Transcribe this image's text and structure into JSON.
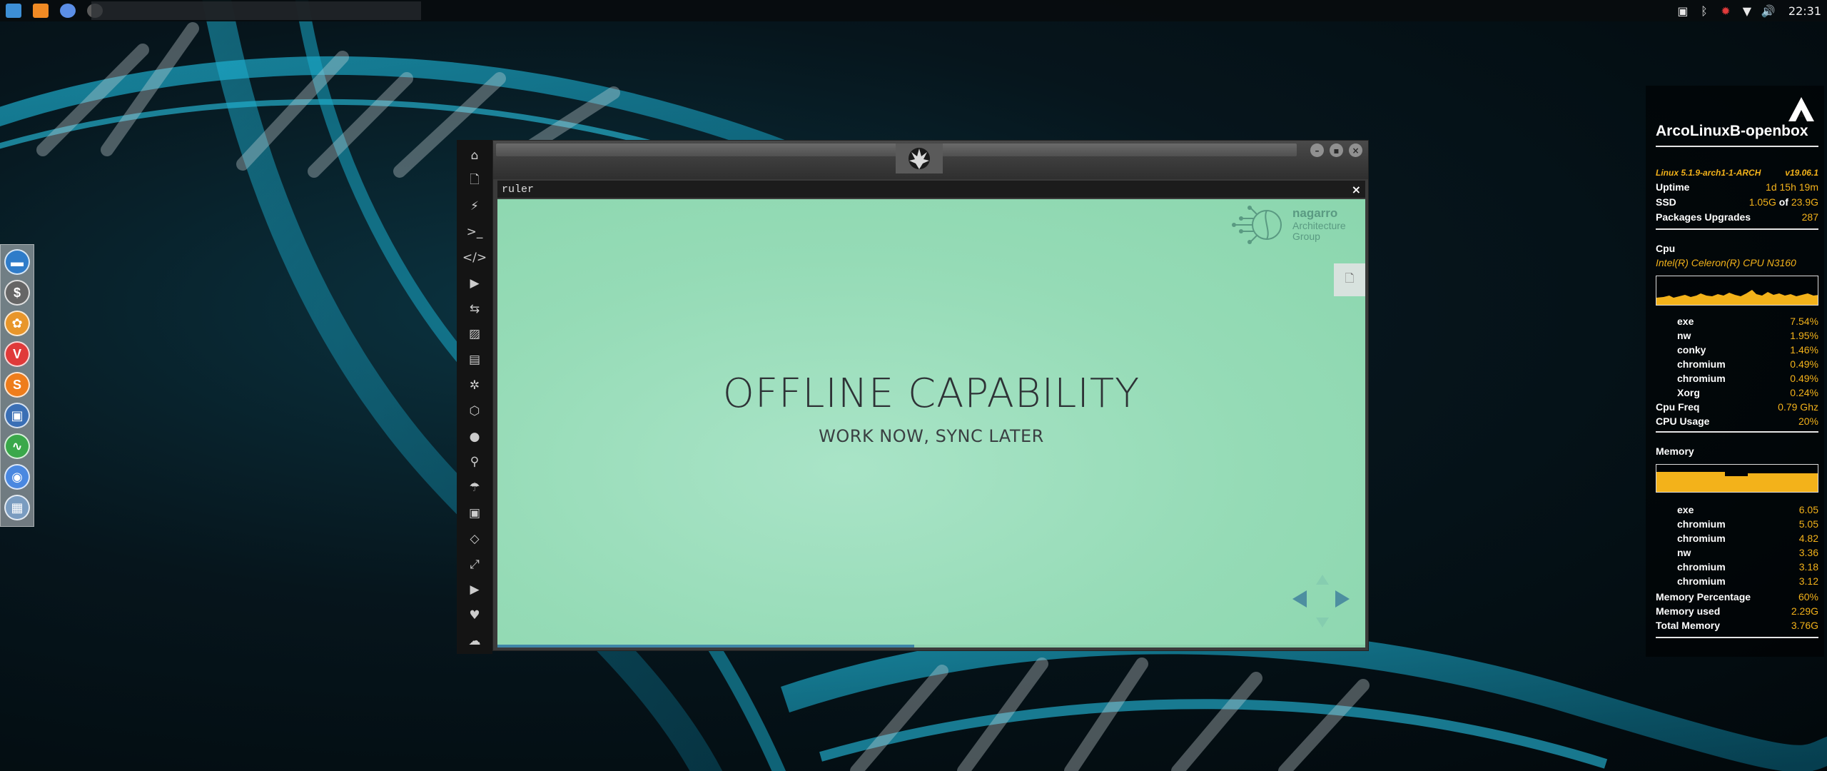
{
  "desktop": {
    "launchers": [
      {
        "name": "file-manager-icon",
        "color": "#3d8fd6"
      },
      {
        "name": "sublime-text-icon",
        "color": "#f08a24"
      },
      {
        "name": "chromium-icon",
        "color": "#5b8ee6"
      },
      {
        "name": "app-launcher-icon",
        "color": "#5a5a5a"
      }
    ],
    "tray": {
      "icons": [
        "screenshot-icon",
        "bluetooth-icon",
        "update-notifier-icon",
        "wifi-icon",
        "volume-icon"
      ],
      "clock": "22:31"
    },
    "dock": [
      {
        "name": "dock-file-manager",
        "icon": "folder-icon",
        "glyph": "▬",
        "color": "#2f7cc9"
      },
      {
        "name": "dock-terminal",
        "icon": "terminal-icon",
        "glyph": "$",
        "color": "#666666"
      },
      {
        "name": "dock-settings",
        "icon": "settings-icon",
        "glyph": "✿",
        "color": "#e8962b"
      },
      {
        "name": "dock-vivaldi",
        "icon": "vivaldi-icon",
        "glyph": "V",
        "color": "#e03a3a"
      },
      {
        "name": "dock-sublime",
        "icon": "sublime-icon",
        "glyph": "S",
        "color": "#ee7d1c"
      },
      {
        "name": "dock-screenshot",
        "icon": "screenshot-icon",
        "glyph": "▣",
        "color": "#3a6fb5"
      },
      {
        "name": "dock-monitor",
        "icon": "system-monitor-icon",
        "glyph": "∿",
        "color": "#3aa84a"
      },
      {
        "name": "dock-chromium",
        "icon": "chromium-icon",
        "glyph": "◉",
        "color": "#4a88e0"
      },
      {
        "name": "dock-workspaces",
        "icon": "workspaces-icon",
        "glyph": "▦",
        "color": "#7a9cc0"
      }
    ]
  },
  "sidebar": [
    {
      "name": "home-icon",
      "glyph": "⌂"
    },
    {
      "name": "document-icon",
      "glyph": "🗋"
    },
    {
      "name": "lightning-icon",
      "glyph": "⚡"
    },
    {
      "name": "terminal-icon",
      "glyph": ">_"
    },
    {
      "name": "code-icon",
      "glyph": "</>"
    },
    {
      "name": "play-icon",
      "glyph": "▶"
    },
    {
      "name": "translate-icon",
      "glyph": "⇆"
    },
    {
      "name": "image-icon",
      "glyph": "▨"
    },
    {
      "name": "newspaper-icon",
      "glyph": "▤"
    },
    {
      "name": "empire-icon",
      "glyph": "✲"
    },
    {
      "name": "hexagon-icon",
      "glyph": "⬡"
    },
    {
      "name": "globe-icon",
      "glyph": "●"
    },
    {
      "name": "search-icon",
      "glyph": "⚲"
    },
    {
      "name": "umbrella-icon",
      "glyph": "☂"
    },
    {
      "name": "contact-icon",
      "glyph": "▣"
    },
    {
      "name": "code-diamond-icon",
      "glyph": "◇"
    },
    {
      "name": "expand-icon",
      "glyph": "⤢"
    },
    {
      "name": "youtube-icon",
      "glyph": "▶"
    },
    {
      "name": "heart-icon",
      "glyph": "♥"
    },
    {
      "name": "cloud-icon",
      "glyph": "☁"
    }
  ],
  "window": {
    "tab_title": "ruler",
    "close_glyph": "×",
    "controls": {
      "minimize": "–",
      "maximize": "▪",
      "close": "×"
    }
  },
  "slide": {
    "title": "OFFLINE CAPABILITY",
    "subtitle": "WORK NOW, SYNC LATER",
    "logo_brand": "nagarro",
    "logo_line1": "Architecture",
    "logo_line2": "Group",
    "progress_fraction": 0.48,
    "accent": "#3f86a8"
  },
  "conky": {
    "hostname": "ArcoLinuxB-openbox",
    "kernel": "Linux 5.1.9-arch1-1-ARCH",
    "version": "v19.06.1",
    "uptime_label": "Uptime",
    "uptime": "1d 15h 19m",
    "ssd_label": "SSD",
    "ssd_used": "1.05G",
    "ssd_of": "of",
    "ssd_total": "23.9G",
    "packages_label": "Packages Upgrades",
    "packages": "287",
    "cpu_label": "Cpu",
    "cpu_model": "Intel(R) Celeron(R) CPU  N3160",
    "cpu_procs": [
      {
        "name": "exe",
        "value": "7.54%"
      },
      {
        "name": "nw",
        "value": "1.95%"
      },
      {
        "name": "conky",
        "value": "1.46%"
      },
      {
        "name": "chromium",
        "value": "0.49%"
      },
      {
        "name": "chromium",
        "value": "0.49%"
      },
      {
        "name": "Xorg",
        "value": "0.24%"
      }
    ],
    "cpu_freq_label": "Cpu Freq",
    "cpu_freq": "0.79 Ghz",
    "cpu_usage_label": "CPU Usage",
    "cpu_usage": "20%",
    "memory_label": "Memory",
    "mem_procs": [
      {
        "name": "exe",
        "value": "6.05"
      },
      {
        "name": "chromium",
        "value": "5.05"
      },
      {
        "name": "chromium",
        "value": "4.82"
      },
      {
        "name": "nw",
        "value": "3.36"
      },
      {
        "name": "chromium",
        "value": "3.18"
      },
      {
        "name": "chromium",
        "value": "3.12"
      }
    ],
    "mem_pct_label": "Memory Percentage",
    "mem_pct": "60%",
    "mem_used_label": "Memory used",
    "mem_used": "2.29G",
    "mem_total_label": "Total Memory",
    "mem_total": "3.76G",
    "accent": "#f3b21a"
  }
}
